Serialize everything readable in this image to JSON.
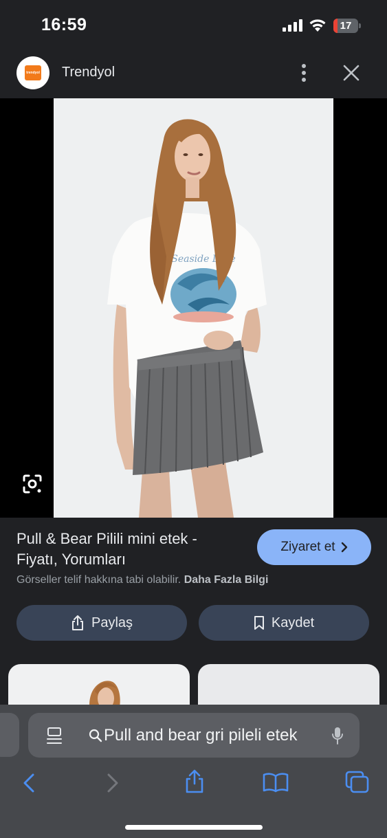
{
  "status_bar": {
    "time": "16:59",
    "battery_level": "17",
    "battery_fraction": 0.17,
    "icons": [
      "signal-icon",
      "wifi-icon",
      "battery-icon"
    ]
  },
  "header": {
    "site_name": "Trendyol",
    "logo_text": "trendyol",
    "icons": [
      "more-icon",
      "close-icon"
    ]
  },
  "image_viewer": {
    "shirt_print_text": "Seaside Love",
    "icons": [
      "lens-icon"
    ]
  },
  "result": {
    "title": "Pull & Bear Pilili mini etek - Fiyatı, Yorumları",
    "visit_label": "Ziyaret et",
    "copyright_text": "Görseller telif hakkına tabi olabilir.",
    "learn_more_label": "Daha Fazla Bilgi",
    "share_label": "Paylaş",
    "save_label": "Kaydet"
  },
  "browser_toolbar": {
    "address_text": "Pull and bear gri pileli etek",
    "icons": [
      "reader-icon",
      "search-icon",
      "mic-icon",
      "back-icon",
      "forward-icon",
      "share-icon",
      "bookmarks-icon",
      "tabs-icon"
    ]
  },
  "colors": {
    "background": "#202124",
    "accent": "#8ab4f8",
    "pill_button": "#394457",
    "battery_low": "#ea4335",
    "toolbar": "#46484c"
  }
}
